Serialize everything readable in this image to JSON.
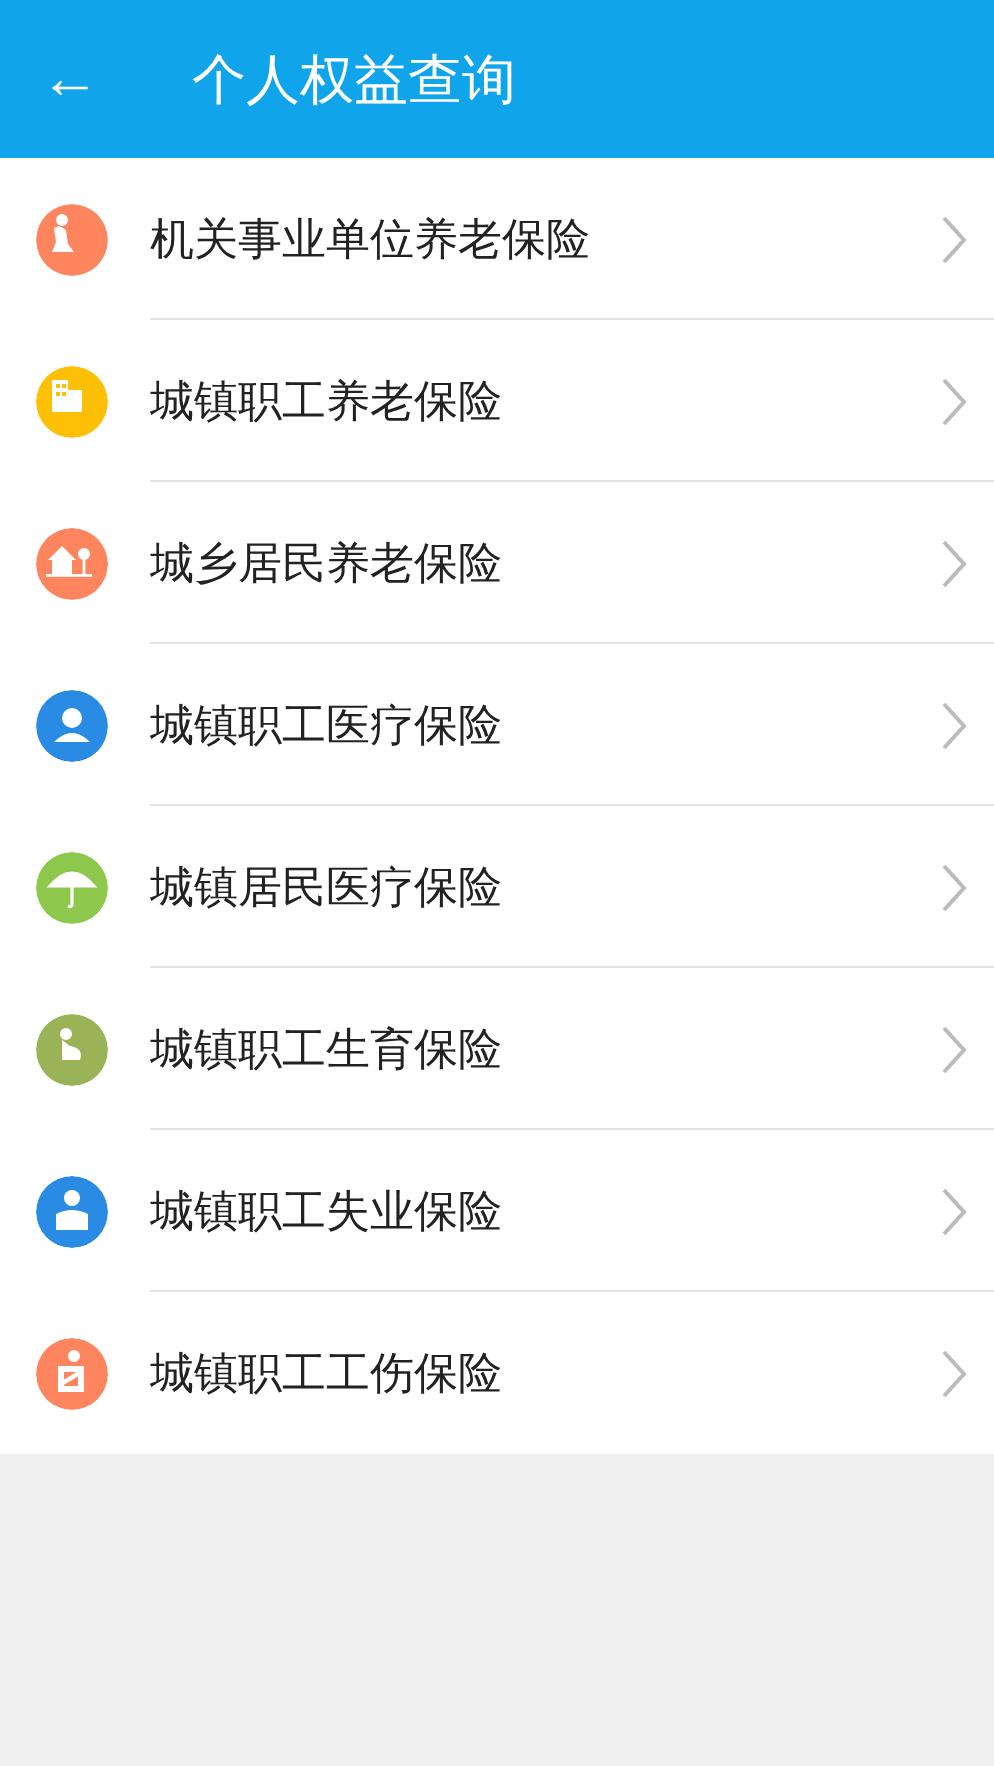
{
  "header": {
    "back": "←",
    "title": "个人权益查询"
  },
  "items": [
    {
      "label": "机关事业单位养老保险",
      "kind": "elder",
      "color": "#fe855e"
    },
    {
      "label": "城镇职工养老保险",
      "kind": "building",
      "color": "#fec006"
    },
    {
      "label": "城乡居民养老保险",
      "kind": "house",
      "color": "#fe855e"
    },
    {
      "label": "城镇职工医疗保险",
      "kind": "person",
      "color": "#2a8be5"
    },
    {
      "label": "城镇居民医疗保险",
      "kind": "umbrella",
      "color": "#8dc84c"
    },
    {
      "label": "城镇职工生育保险",
      "kind": "mother",
      "color": "#99b356"
    },
    {
      "label": "城镇职工失业保险",
      "kind": "worker",
      "color": "#2a8be5"
    },
    {
      "label": "城镇职工工伤保险",
      "kind": "injury",
      "color": "#fe855e"
    }
  ]
}
